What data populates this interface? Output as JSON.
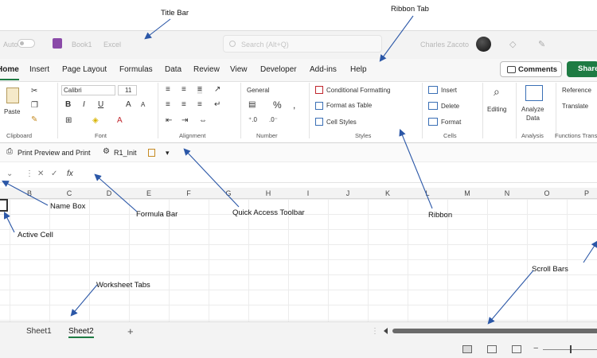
{
  "titlebar": {
    "autosave": "Auto",
    "filename": "Book1",
    "saved_state": "Excel",
    "search_placeholder": "Search (Alt+Q)",
    "user": "Charles Zacoto"
  },
  "menu": {
    "tabs": [
      "Home",
      "Insert",
      "Page Layout",
      "Formulas",
      "Data",
      "Review",
      "View",
      "Developer",
      "Add-ins",
      "Help"
    ],
    "comments_label": "Comments",
    "share_label": "Share"
  },
  "ribbon": {
    "clipboard": {
      "paste": "Paste",
      "label": "Clipboard"
    },
    "font": {
      "name": "Calibri",
      "size": "11",
      "label": "Font"
    },
    "alignment": {
      "label": "Alignment"
    },
    "number": {
      "format": "General",
      "label": "Number"
    },
    "styles": {
      "conditional": "Conditional Formatting",
      "format_table": "Format as Table",
      "cell_styles": "Cell Styles",
      "label": "Styles"
    },
    "cells": {
      "insert": "Insert",
      "delete": "Delete",
      "format": "Format",
      "label": "Cells"
    },
    "editing": {
      "label": "Editing"
    },
    "analysis": {
      "analyze_data_1": "Analyze",
      "analyze_data_2": "Data",
      "label": "Analysis"
    },
    "functions": {
      "reference": "Reference",
      "translate": "Translate",
      "label": "Functions Translate"
    }
  },
  "qat": {
    "print_preview": "Print Preview and Print",
    "macro": "R1_Init"
  },
  "formula": {
    "fx": "fx"
  },
  "columns": [
    "B",
    "C",
    "D",
    "E",
    "F",
    "G",
    "H",
    "I",
    "J",
    "K",
    "L",
    "M",
    "N",
    "O",
    "P"
  ],
  "sheets": {
    "sheet1": "Sheet1",
    "sheet2": "Sheet2",
    "add": "+"
  },
  "annotations": {
    "title_bar": "Title Bar",
    "ribbon_tab": "Ribbon Tab",
    "name_box": "Name Box",
    "formula_bar": "Formula Bar",
    "quick_access": "Quick Access Toolbar",
    "ribbon": "Ribbon",
    "active_cell": "Active Cell",
    "worksheet_tabs": "Worksheet Tabs",
    "scroll_bars": "Scroll Bars"
  }
}
